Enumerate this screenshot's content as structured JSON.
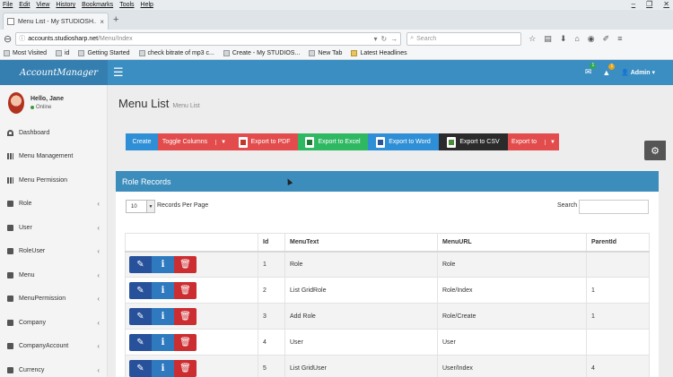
{
  "browser": {
    "menu": [
      "File",
      "Edit",
      "View",
      "History",
      "Bookmarks",
      "Tools",
      "Help"
    ],
    "window_controls": [
      "–",
      "❐",
      "✕"
    ],
    "tab_title": "Menu List - My STUDIOSH...",
    "tab_close": "×",
    "new_tab": "+",
    "url_domain": "accounts.studiosharp.net",
    "url_path": "/Menu/Index",
    "search_placeholder": "Search",
    "bookmarks": [
      "Most Visited",
      "id",
      "Getting Started",
      "check bitrate of mp3 c...",
      "Create - My STUDIOS...",
      "New Tab",
      "Latest Headlines"
    ]
  },
  "header": {
    "logo": "AccountManager",
    "mail_badge": "1",
    "alert_badge": "1",
    "user_label": "Admin",
    "colors": {
      "primary": "#3b8ec2",
      "logo_bg": "#357fb0"
    }
  },
  "sidebar": {
    "greeting": "Hello, Jane",
    "status": "Online",
    "items": [
      {
        "label": "Dashboard",
        "icon": "dashboard-icon",
        "arrow": false
      },
      {
        "label": "Menu Management",
        "icon": "grid-icon",
        "arrow": false
      },
      {
        "label": "Menu Permission",
        "icon": "grid-icon",
        "arrow": false
      },
      {
        "label": "Role",
        "icon": "folder-icon",
        "arrow": true
      },
      {
        "label": "User",
        "icon": "folder-icon",
        "arrow": true
      },
      {
        "label": "RoleUser",
        "icon": "folder-icon",
        "arrow": true
      },
      {
        "label": "Menu",
        "icon": "folder-icon",
        "arrow": true
      },
      {
        "label": "MenuPermission",
        "icon": "folder-icon",
        "arrow": true
      },
      {
        "label": "Company",
        "icon": "folder-icon",
        "arrow": true
      },
      {
        "label": "CompanyAccount",
        "icon": "folder-icon",
        "arrow": true
      },
      {
        "label": "Currency",
        "icon": "folder-icon",
        "arrow": true
      }
    ]
  },
  "page": {
    "title": "Menu List",
    "subtitle": "Menu List"
  },
  "toolbar": {
    "create": "Create",
    "toggle_columns": "Toggle Columns",
    "export_pdf": "Export to PDF",
    "export_excel": "Export to Excel",
    "export_word": "Export to Word",
    "export_csv": "Export to CSV",
    "export_to": "Export to"
  },
  "panel": {
    "title": "Role Records",
    "page_length": "10",
    "records_per_page": "Records Per Page",
    "search_label": "Search"
  },
  "table": {
    "columns": [
      "",
      "Id",
      "MenuText",
      "MenuURL",
      "ParentId"
    ],
    "rows": [
      {
        "id": "1",
        "menu_text": "Role",
        "menu_url": "Role",
        "parent_id": ""
      },
      {
        "id": "2",
        "menu_text": "List GridRole",
        "menu_url": "Role/Index",
        "parent_id": "1"
      },
      {
        "id": "3",
        "menu_text": "Add Role",
        "menu_url": "Role/Create",
        "parent_id": "1"
      },
      {
        "id": "4",
        "menu_text": "User",
        "menu_url": "User",
        "parent_id": ""
      },
      {
        "id": "5",
        "menu_text": "List GridUser",
        "menu_url": "User/Index",
        "parent_id": "4"
      }
    ]
  }
}
